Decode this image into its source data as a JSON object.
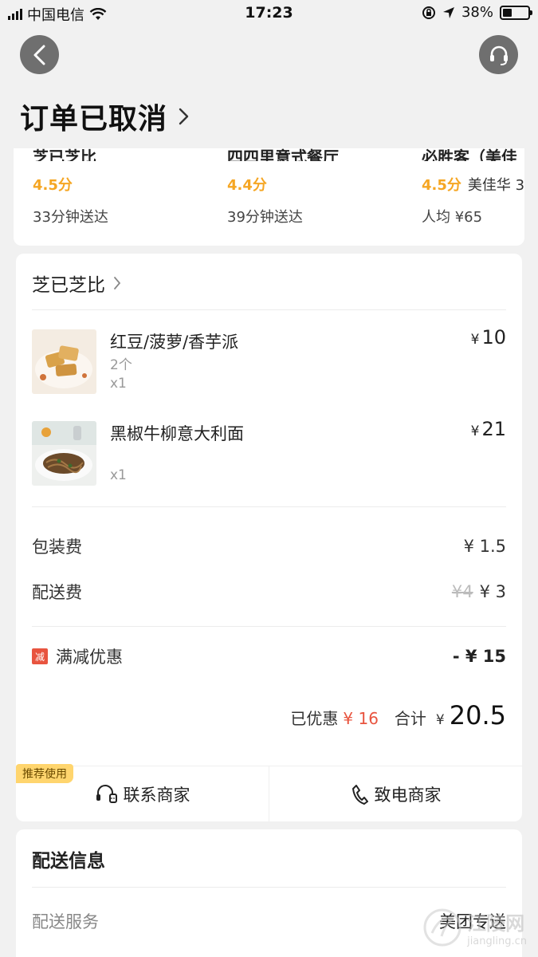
{
  "status_bar": {
    "carrier": "中国电信",
    "time": "17:23",
    "battery": "38%",
    "battery_level": 0.38
  },
  "header": {
    "title": "订单已取消",
    "chevron": "›"
  },
  "recommendations": [
    {
      "name": "芝已芝比",
      "score": "4.5分",
      "extra": "",
      "sub": "33分钟送达"
    },
    {
      "name": "四四里意式餐厅",
      "score": "4.4分",
      "extra": "",
      "sub": "39分钟送达"
    },
    {
      "name": "必胜客（美佳",
      "score": "4.5分",
      "extra": "美佳华 3",
      "sub": "人均 ¥65"
    }
  ],
  "order": {
    "shop_name": "芝已芝比",
    "currency": "¥",
    "items": [
      {
        "name": "红豆/菠萝/香芋派",
        "spec": "2个",
        "qty": "x1",
        "price": "10"
      },
      {
        "name": "黑椒牛柳意大利面",
        "spec": "",
        "qty": "x1",
        "price": "21"
      }
    ],
    "packaging_label": "包装费",
    "packaging_value": "¥ 1.5",
    "delivery_fee_label": "配送费",
    "delivery_fee_original": "¥4",
    "delivery_fee_value": "¥ 3",
    "discount_badge": "减",
    "discount_label": "满减优惠",
    "discount_value": "- ¥ 15",
    "saved_label": "已优惠",
    "saved_value": "¥ 16",
    "total_label": "合计",
    "total_currency": "¥",
    "total_value": "20.5",
    "recommend_tag": "推荐使用",
    "contact_merchant": "联系商家",
    "call_merchant": "致电商家"
  },
  "delivery_info": {
    "title": "配送信息",
    "service_label": "配送服务",
    "service_value": "美团专送"
  },
  "watermark": {
    "text": "江陵网",
    "sub": "jiangling.cn"
  },
  "colors": {
    "accent_orange": "#f5a623",
    "discount_red": "#e8543f",
    "tag_yellow": "#ffd56e"
  }
}
